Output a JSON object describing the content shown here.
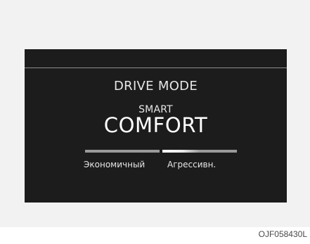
{
  "screen": {
    "title": "DRIVE MODE",
    "subtitle": "SMART",
    "mode": "COMFORT",
    "left_label": "Экономичный",
    "right_label": "Агрессивн.",
    "gauge_fill_fraction": 0.5
  },
  "figure_code": "OJF058430L",
  "colors": {
    "screen_bg": "#1c1c1c",
    "panel_bg": "#f2f2f2",
    "bar_gray": "#9a9a9a",
    "text": "#e6e6e6"
  }
}
